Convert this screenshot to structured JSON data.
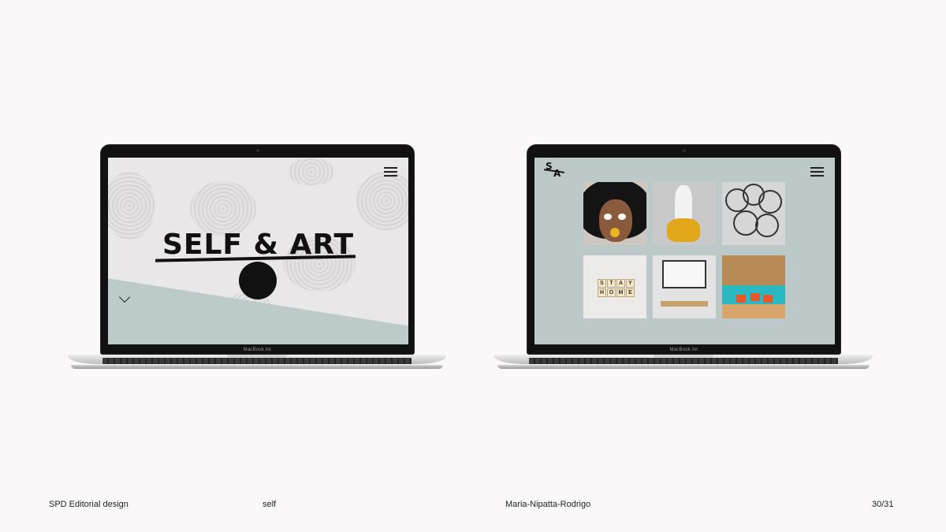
{
  "laptops": {
    "left": {
      "brand": "MacBook Air",
      "hero_title": "SELF & ART"
    },
    "right": {
      "brand": "MacBook Air",
      "logo_top": "S",
      "logo_bottom": "A",
      "tile_text": {
        "scrabble_row1": [
          "S",
          "T",
          "A",
          "Y"
        ],
        "scrabble_row2": [
          "H",
          "O",
          "M",
          "E"
        ]
      }
    }
  },
  "footer": {
    "left": "SPD Editorial design",
    "middle": "self",
    "author": "Maria-Nipatta-Rodrigo",
    "page": "30/31"
  },
  "icons": {
    "menu": "hamburger-icon",
    "scroll": "chevron-down-icon"
  },
  "colors": {
    "page_bg": "#faf8f8",
    "hero_bg": "#e9e7e7",
    "accent_teal": "#bccaca"
  }
}
